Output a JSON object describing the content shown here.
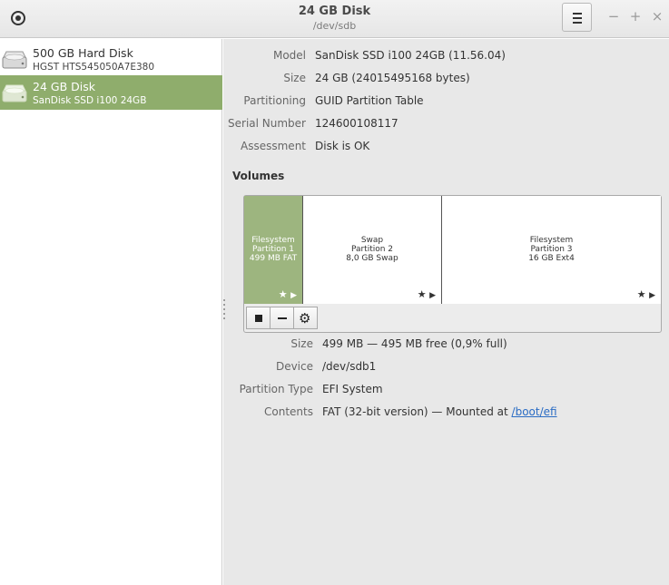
{
  "header": {
    "title": "24 GB Disk",
    "subtitle": "/dev/sdb",
    "minimize": "−",
    "maximize": "+",
    "close": "×"
  },
  "sidebar": {
    "items": [
      {
        "name": "500 GB Hard Disk",
        "sub": "HGST HTS545050A7E380",
        "selected": false
      },
      {
        "name": "24 GB Disk",
        "sub": "SanDisk SSD i100 24GB",
        "selected": true
      }
    ]
  },
  "disk": {
    "labels": {
      "model": "Model",
      "size": "Size",
      "partitioning": "Partitioning",
      "serial": "Serial Number",
      "assessment": "Assessment"
    },
    "values": {
      "model": "SanDisk SSD i100 24GB (11.56.04)",
      "size": "24 GB (24015495168 bytes)",
      "partitioning": "GUID Partition Table",
      "serial": "124600108117",
      "assessment": "Disk is OK"
    }
  },
  "volumes": {
    "heading": "Volumes",
    "partitions": [
      {
        "line1": "Filesystem",
        "line2": "Partition 1",
        "line3": "499 MB FAT",
        "selected": true
      },
      {
        "line1": "Swap",
        "line2": "Partition 2",
        "line3": "8,0 GB Swap",
        "selected": false
      },
      {
        "line1": "Filesystem",
        "line2": "Partition 3",
        "line3": "16 GB Ext4",
        "selected": false
      }
    ],
    "icons": {
      "star": "★",
      "play": "▶",
      "gear": "⚙"
    }
  },
  "partition_details": {
    "labels": {
      "size": "Size",
      "device": "Device",
      "type": "Partition Type",
      "contents": "Contents"
    },
    "values": {
      "size": "499 MB — 495 MB free (0,9% full)",
      "device": "/dev/sdb1",
      "type": "EFI System",
      "contents_prefix": "FAT (32-bit version) — Mounted at ",
      "contents_link": "/boot/efi"
    }
  }
}
